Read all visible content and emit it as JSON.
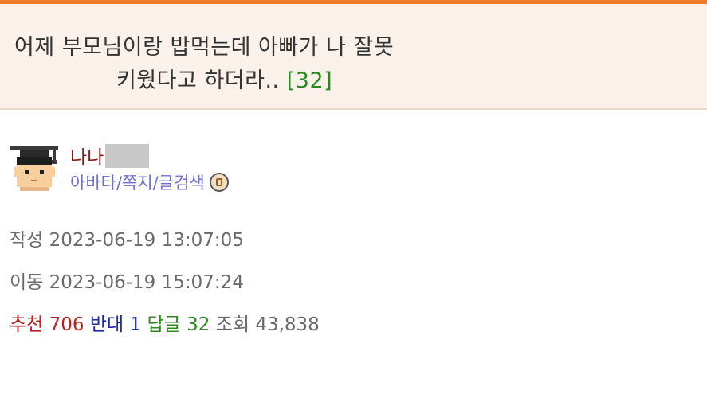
{
  "post": {
    "title_line1": "어제 부모님이랑 밥먹는데 아빠가 나 잘못",
    "title_line2": "키웠다고 하더라..",
    "reply_count_label": "[32]"
  },
  "author": {
    "name": "나나",
    "links_label": "아바타/쪽지/글검색",
    "avatar_icon": "graduate-avatar-icon",
    "badge_icon": "level-badge-icon"
  },
  "meta": {
    "written_label": "작성",
    "written_value": "2023-06-19 13:07:05",
    "moved_label": "이동",
    "moved_value": "2023-06-19 15:07:24"
  },
  "stats": {
    "recommend_label": "추천",
    "recommend_value": "706",
    "oppose_label": "반대",
    "oppose_value": "1",
    "reply_label": "답글",
    "reply_value": "32",
    "views_label": "조회",
    "views_value": "43,838"
  },
  "colors": {
    "accent": "#f07a2d",
    "title_bg": "#faf1ea",
    "author_name": "#8a1a1a",
    "links": "#7070d0",
    "recommend": "#c0201c",
    "oppose": "#1c2aa6",
    "reply": "#2b8a1e"
  }
}
